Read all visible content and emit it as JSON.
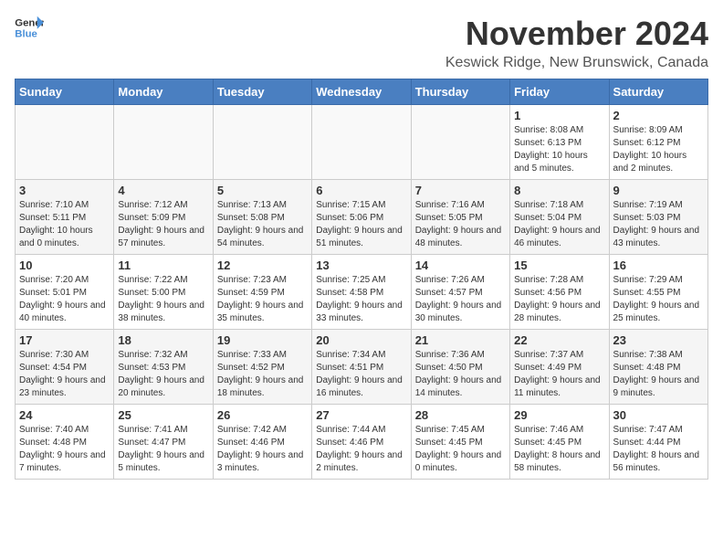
{
  "header": {
    "logo_general": "General",
    "logo_blue": "Blue",
    "title": "November 2024",
    "subtitle": "Keswick Ridge, New Brunswick, Canada"
  },
  "columns": [
    "Sunday",
    "Monday",
    "Tuesday",
    "Wednesday",
    "Thursday",
    "Friday",
    "Saturday"
  ],
  "rows": [
    [
      {
        "day": "",
        "info": ""
      },
      {
        "day": "",
        "info": ""
      },
      {
        "day": "",
        "info": ""
      },
      {
        "day": "",
        "info": ""
      },
      {
        "day": "",
        "info": ""
      },
      {
        "day": "1",
        "info": "Sunrise: 8:08 AM\nSunset: 6:13 PM\nDaylight: 10 hours and 5 minutes."
      },
      {
        "day": "2",
        "info": "Sunrise: 8:09 AM\nSunset: 6:12 PM\nDaylight: 10 hours and 2 minutes."
      }
    ],
    [
      {
        "day": "3",
        "info": "Sunrise: 7:10 AM\nSunset: 5:11 PM\nDaylight: 10 hours and 0 minutes."
      },
      {
        "day": "4",
        "info": "Sunrise: 7:12 AM\nSunset: 5:09 PM\nDaylight: 9 hours and 57 minutes."
      },
      {
        "day": "5",
        "info": "Sunrise: 7:13 AM\nSunset: 5:08 PM\nDaylight: 9 hours and 54 minutes."
      },
      {
        "day": "6",
        "info": "Sunrise: 7:15 AM\nSunset: 5:06 PM\nDaylight: 9 hours and 51 minutes."
      },
      {
        "day": "7",
        "info": "Sunrise: 7:16 AM\nSunset: 5:05 PM\nDaylight: 9 hours and 48 minutes."
      },
      {
        "day": "8",
        "info": "Sunrise: 7:18 AM\nSunset: 5:04 PM\nDaylight: 9 hours and 46 minutes."
      },
      {
        "day": "9",
        "info": "Sunrise: 7:19 AM\nSunset: 5:03 PM\nDaylight: 9 hours and 43 minutes."
      }
    ],
    [
      {
        "day": "10",
        "info": "Sunrise: 7:20 AM\nSunset: 5:01 PM\nDaylight: 9 hours and 40 minutes."
      },
      {
        "day": "11",
        "info": "Sunrise: 7:22 AM\nSunset: 5:00 PM\nDaylight: 9 hours and 38 minutes."
      },
      {
        "day": "12",
        "info": "Sunrise: 7:23 AM\nSunset: 4:59 PM\nDaylight: 9 hours and 35 minutes."
      },
      {
        "day": "13",
        "info": "Sunrise: 7:25 AM\nSunset: 4:58 PM\nDaylight: 9 hours and 33 minutes."
      },
      {
        "day": "14",
        "info": "Sunrise: 7:26 AM\nSunset: 4:57 PM\nDaylight: 9 hours and 30 minutes."
      },
      {
        "day": "15",
        "info": "Sunrise: 7:28 AM\nSunset: 4:56 PM\nDaylight: 9 hours and 28 minutes."
      },
      {
        "day": "16",
        "info": "Sunrise: 7:29 AM\nSunset: 4:55 PM\nDaylight: 9 hours and 25 minutes."
      }
    ],
    [
      {
        "day": "17",
        "info": "Sunrise: 7:30 AM\nSunset: 4:54 PM\nDaylight: 9 hours and 23 minutes."
      },
      {
        "day": "18",
        "info": "Sunrise: 7:32 AM\nSunset: 4:53 PM\nDaylight: 9 hours and 20 minutes."
      },
      {
        "day": "19",
        "info": "Sunrise: 7:33 AM\nSunset: 4:52 PM\nDaylight: 9 hours and 18 minutes."
      },
      {
        "day": "20",
        "info": "Sunrise: 7:34 AM\nSunset: 4:51 PM\nDaylight: 9 hours and 16 minutes."
      },
      {
        "day": "21",
        "info": "Sunrise: 7:36 AM\nSunset: 4:50 PM\nDaylight: 9 hours and 14 minutes."
      },
      {
        "day": "22",
        "info": "Sunrise: 7:37 AM\nSunset: 4:49 PM\nDaylight: 9 hours and 11 minutes."
      },
      {
        "day": "23",
        "info": "Sunrise: 7:38 AM\nSunset: 4:48 PM\nDaylight: 9 hours and 9 minutes."
      }
    ],
    [
      {
        "day": "24",
        "info": "Sunrise: 7:40 AM\nSunset: 4:48 PM\nDaylight: 9 hours and 7 minutes."
      },
      {
        "day": "25",
        "info": "Sunrise: 7:41 AM\nSunset: 4:47 PM\nDaylight: 9 hours and 5 minutes."
      },
      {
        "day": "26",
        "info": "Sunrise: 7:42 AM\nSunset: 4:46 PM\nDaylight: 9 hours and 3 minutes."
      },
      {
        "day": "27",
        "info": "Sunrise: 7:44 AM\nSunset: 4:46 PM\nDaylight: 9 hours and 2 minutes."
      },
      {
        "day": "28",
        "info": "Sunrise: 7:45 AM\nSunset: 4:45 PM\nDaylight: 9 hours and 0 minutes."
      },
      {
        "day": "29",
        "info": "Sunrise: 7:46 AM\nSunset: 4:45 PM\nDaylight: 8 hours and 58 minutes."
      },
      {
        "day": "30",
        "info": "Sunrise: 7:47 AM\nSunset: 4:44 PM\nDaylight: 8 hours and 56 minutes."
      }
    ]
  ]
}
